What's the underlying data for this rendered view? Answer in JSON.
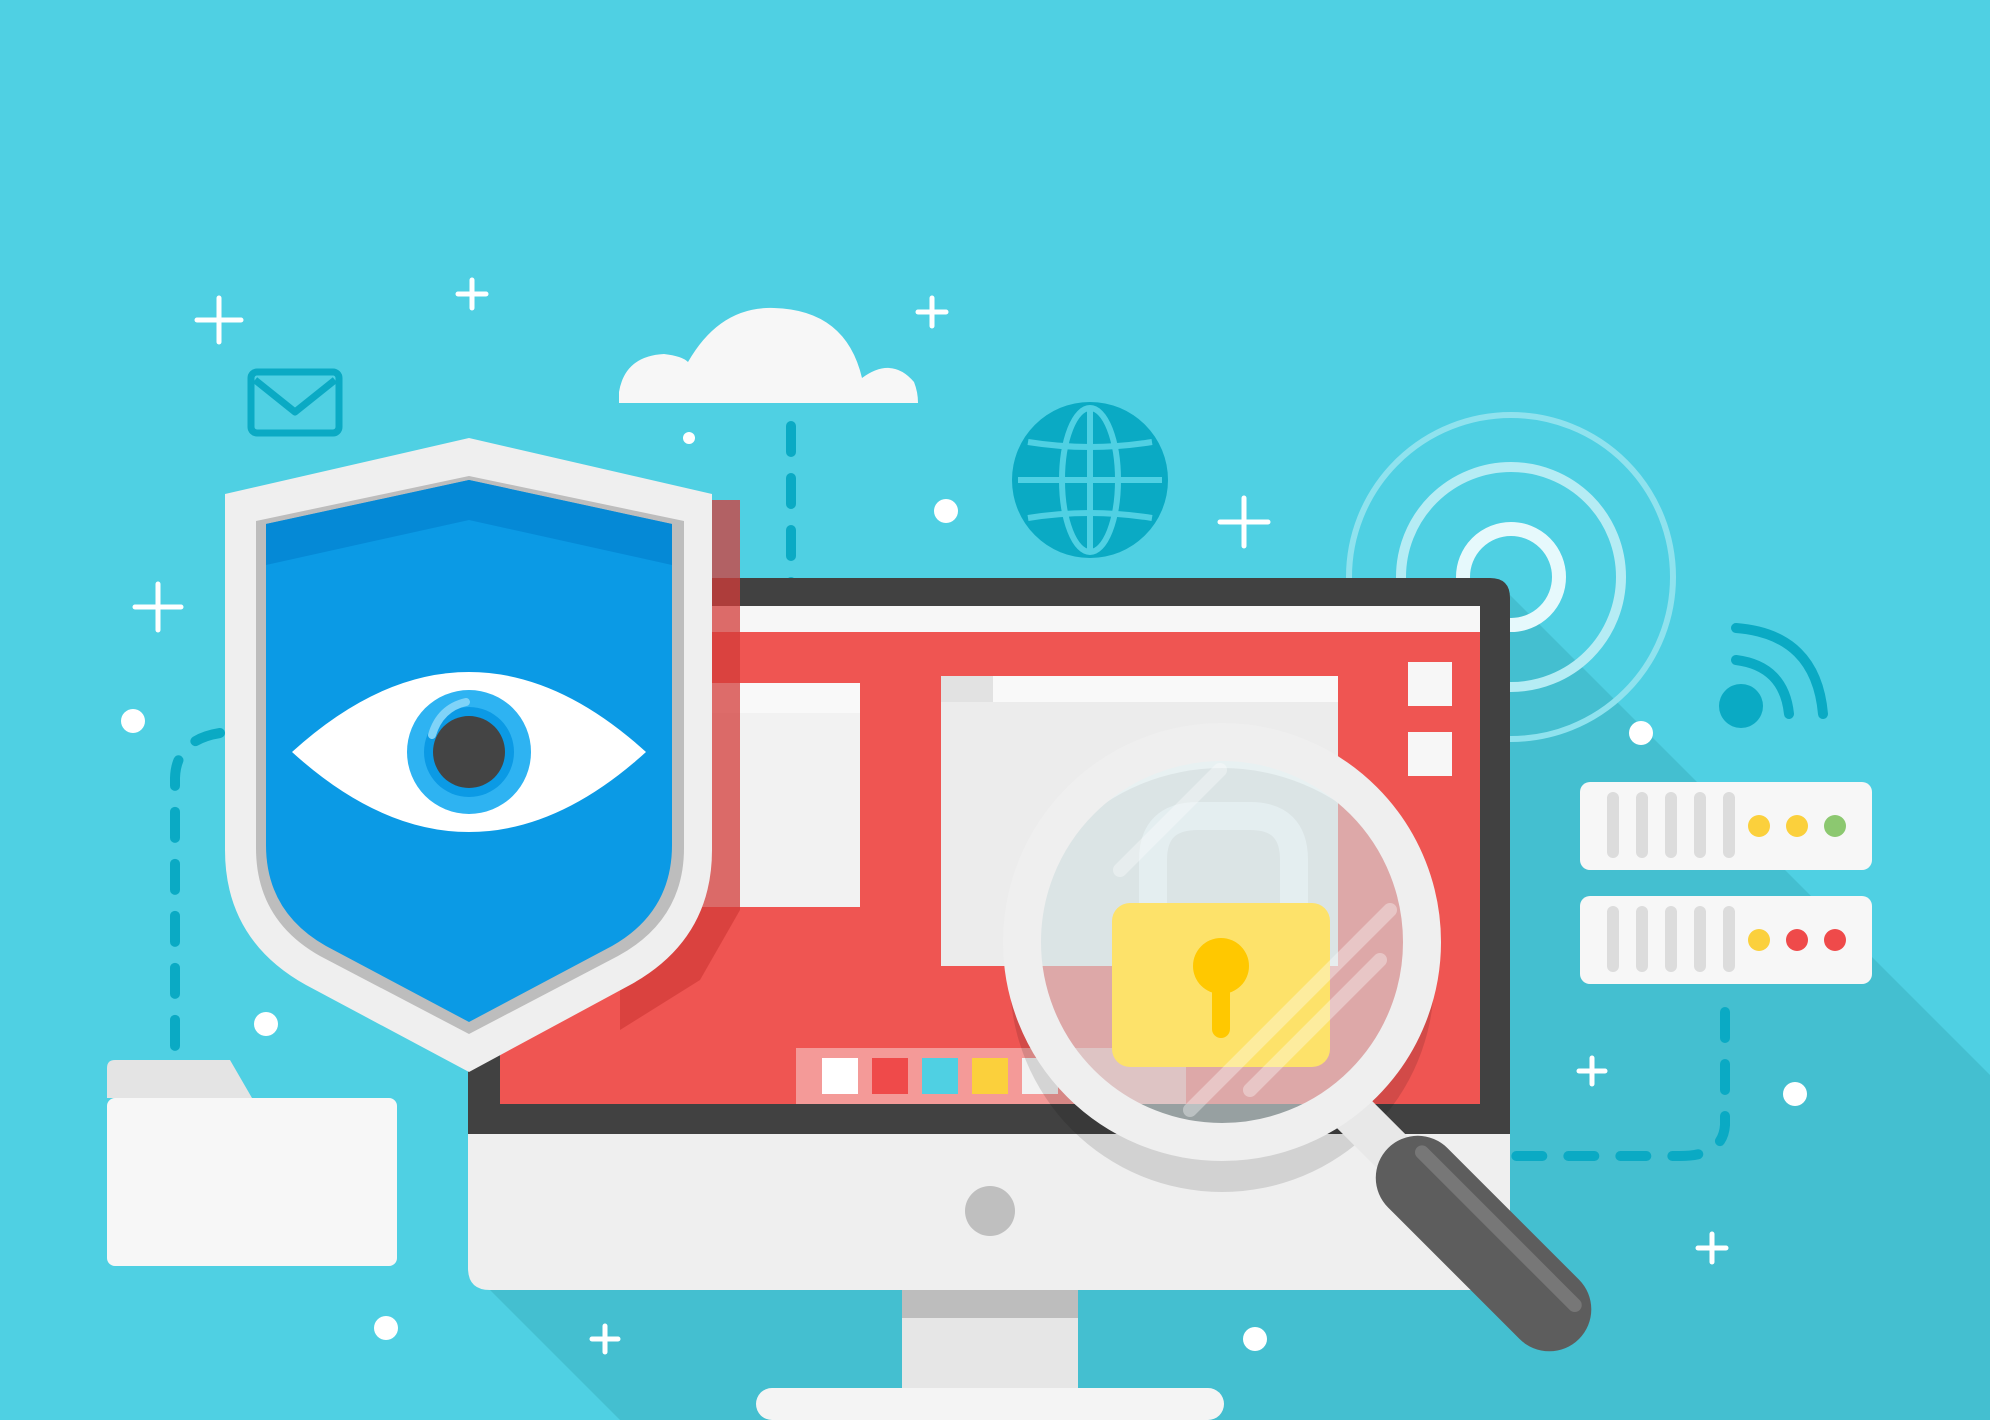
{
  "colors": {
    "background": "#4fd0e3",
    "long_shadow": "#44bfd0",
    "monitor_frame": "#444444",
    "screen_red": "#ef5552",
    "shield_blue": "#0b9ae5",
    "shield_blue_dark": "#0589d6",
    "shield_rim": "#efefef",
    "lock_yellow": "#fde26a",
    "keyhole": "#ffc800",
    "teal_line": "#0aaac4",
    "white": "#ffffff",
    "status_yellow": "#fbd03c",
    "status_green": "#8cc870",
    "status_red": "#ef4a4a",
    "handle_gray": "#5d5d5d"
  },
  "icons": [
    "envelope-icon",
    "cloud-icon",
    "globe-icon",
    "wifi-signal-icon",
    "radar-target-icon",
    "shield-eye-icon",
    "padlock-icon",
    "magnifier-icon",
    "folder-icon",
    "server-icon",
    "monitor-icon"
  ],
  "screen_swatches": [
    "#ffffff",
    "#ef4a4a",
    "#4fd0e3",
    "#fbd03c",
    "#f2f2f2"
  ],
  "servers": [
    {
      "lights": [
        "#fbd03c",
        "#fbd03c",
        "#8cc870"
      ]
    },
    {
      "lights": [
        "#fbd03c",
        "#ef4a4a",
        "#ef4a4a"
      ]
    }
  ]
}
